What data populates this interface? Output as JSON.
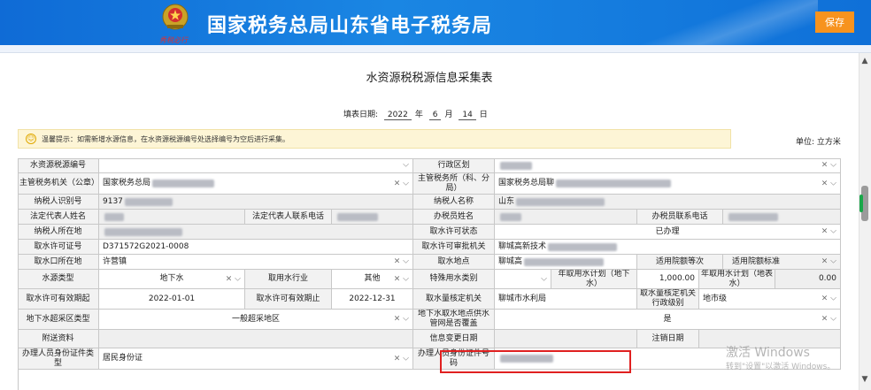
{
  "header": {
    "site_title": "国家税务总局山东省电子税务局",
    "save_label": "保存",
    "emblem_caption": "秀税必行"
  },
  "form": {
    "title": "水资源税税源信息采集表",
    "date_label": "填表日期:",
    "year": "2022",
    "year_unit": "年",
    "month": "6",
    "month_unit": "月",
    "day": "14",
    "day_unit": "日",
    "tip": "温馨提示：如需新增水源信息，在水资源税源编号处选择编号为空后进行采集。",
    "unit": "单位: 立方米"
  },
  "rows": {
    "r1": {
      "l1": "水资源税源编号",
      "l2": "行政区划"
    },
    "r2": {
      "l1": "主管税务机关（公章）",
      "v1": "国家税务总局",
      "l2": "主管税务所（科、分局）",
      "v2": "国家税务总局聊"
    },
    "r3": {
      "l1": "纳税人识别号",
      "v1": "9137",
      "l2": "纳税人名称",
      "v2": "山东"
    },
    "r4": {
      "l1": "法定代表人姓名",
      "l2": "法定代表人联系电话",
      "l3": "办税员姓名",
      "l4": "办税员联系电话"
    },
    "r5": {
      "l1": "纳税人所在地",
      "l2": "取水许可状态",
      "v2": "已办理"
    },
    "r6": {
      "l1": "取水许可证号",
      "v1": "D371572G2021-0008",
      "l2": "取水许可审批机关",
      "v2": "聊城高新技术"
    },
    "r7": {
      "l1": "取水口所在地",
      "v1": "许营镇",
      "l2": "取水地点",
      "v2": "聊城高",
      "l3": "适用院额等次",
      "l4": "适用院额标准"
    },
    "r8": {
      "l1": "水源类型",
      "v1": "地下水",
      "l2": "取用水行业",
      "v2": "其他",
      "l3": "特殊用水类别",
      "l4": "年取用水计划（地下水）",
      "v4": "1,000.00",
      "l5": "年取用水计划（地表水）",
      "v5": "0.00"
    },
    "r9": {
      "l1": "取水许可有效期起",
      "v1": "2022-01-01",
      "l2": "取水许可有效期止",
      "v2": "2022-12-31",
      "l3": "取水量核定机关",
      "v3": "聊城市水利局",
      "l4": "取水量核定机关行政级别",
      "v4": "地市级"
    },
    "r10": {
      "l1": "地下水超采区类型",
      "v1": "一般超采地区",
      "l2": "地下水取水地点供水管网是否覆盖",
      "v2": "是"
    },
    "r11": {
      "l1": "附送资料",
      "l2": "信息变更日期",
      "l3": "注销日期"
    },
    "r12": {
      "l1": "办理人员身份证件类型",
      "v1": "居民身份证",
      "l2": "办理人员身份证件号码"
    }
  },
  "watermark": {
    "line1": "激活 Windows",
    "line2": "转到\"设置\"以激活 Windows。"
  }
}
